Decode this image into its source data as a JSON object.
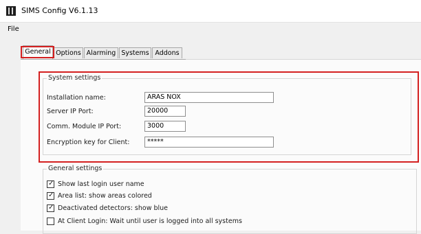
{
  "window": {
    "title": "SIMS Config V6.1.13"
  },
  "menu": {
    "file": "File"
  },
  "tabs": [
    {
      "label": "General"
    },
    {
      "label": "Options"
    },
    {
      "label": "Alarming"
    },
    {
      "label": "Systems"
    },
    {
      "label": "Addons"
    }
  ],
  "system_settings": {
    "legend": "System settings",
    "fields": [
      {
        "label": "Installation name:",
        "value": "ARAS NOX"
      },
      {
        "label": "Server IP Port:",
        "value": "20000"
      },
      {
        "label": "Comm. Module IP Port:",
        "value": "3000"
      },
      {
        "label": "Encryption key for Client:",
        "value": "*****"
      }
    ]
  },
  "general_settings": {
    "legend": "General settings",
    "options": [
      {
        "label": "Show last login user name",
        "checked": true
      },
      {
        "label": "Area list: show areas colored",
        "checked": true
      },
      {
        "label": "Deactivated detectors: show blue",
        "checked": true
      },
      {
        "label": "At Client Login: Wait until user is logged into all systems",
        "checked": false
      }
    ]
  },
  "colors": {
    "highlight": "#d41f1f"
  }
}
